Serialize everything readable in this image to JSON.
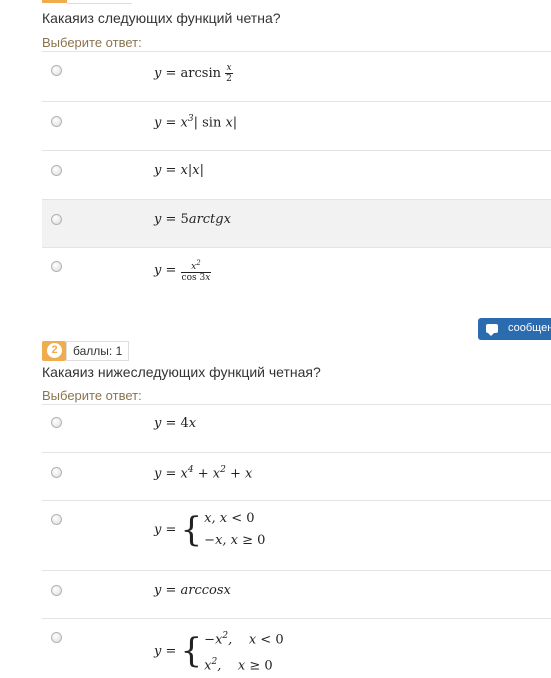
{
  "question1": {
    "text": "Какаяиз следующих функций четна?",
    "prompt": "Выберите ответ:",
    "options": [
      {
        "formula": "y = arcsin x/2"
      },
      {
        "formula": "y = x^3 |sin x|"
      },
      {
        "formula": "y = x|x|"
      },
      {
        "formula": "y = 5arctgx"
      },
      {
        "formula": "y = x^2 / cos 3x"
      }
    ]
  },
  "question2": {
    "number": "2",
    "points": "баллы: 1",
    "text": "Какаяиз нижеследующих функций четная?",
    "prompt": "Выберите ответ:",
    "options": [
      {
        "formula": "y = 4x"
      },
      {
        "formula": "y = x^4 + x^2 + x"
      },
      {
        "formula": "y = { x, x < 0 ; -x, x ≥ 0 }"
      },
      {
        "formula": "y = arccosx"
      },
      {
        "formula": "y = { -x^2, x < 0 ; x^2, x ≥ 0 }"
      }
    ]
  },
  "message_button": {
    "label": "сообщен",
    "icon": "chat-icon"
  },
  "colors": {
    "accent": "#f0ad4e",
    "button": "#2b6cb0",
    "prompt": "#8a7450"
  }
}
